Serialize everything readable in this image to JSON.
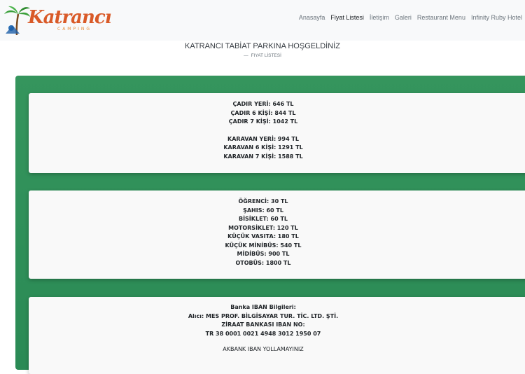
{
  "brand": {
    "name": "Katrancı",
    "tagline": "CAMPING"
  },
  "nav": [
    {
      "label": "Anasayfa",
      "active": false
    },
    {
      "label": "Fiyat Listesi",
      "active": true
    },
    {
      "label": "İletişim",
      "active": false
    },
    {
      "label": "Galeri",
      "active": false
    },
    {
      "label": "Restaurant Menu",
      "active": false
    },
    {
      "label": "Infinity Ruby Hotel",
      "active": false
    }
  ],
  "header": {
    "title": "KATRANCI TABİAT PARKINA HOŞGELDİNİZ",
    "breadcrumb": "FIYAT LİSTESİ"
  },
  "cards": {
    "tent": [
      "ÇADIR YERİ: 646 TL",
      "ÇADIR 6 KİŞİ: 844 TL",
      "ÇADIR 7 KİŞİ: 1042 TL"
    ],
    "caravan": [
      "KARAVAN YERİ: 994 TL",
      "KARAVAN 6 KİŞİ: 1291 TL",
      "KARAVAN 7 KİŞİ: 1588 TL"
    ],
    "entry": [
      "ÖĞRENCİ: 30 TL",
      "ŞAHIS: 60 TL",
      "BİSİKLET: 60 TL",
      "MOTORSİKLET: 120 TL",
      "KÜÇÜK VASITA: 180 TL",
      "KÜÇÜK MİNİBÜS: 540 TL",
      "MİDİBÜS: 900 TL",
      "OTOBÜS: 1800 TL"
    ],
    "bank": [
      "Banka IBAN Bilgileri:",
      "Alıcı: MES PROF. BİLGİSAYAR TUR. TİC. LTD. ŞTİ.",
      "ZİRAAT BANKASI IBAN NO:",
      "TR 38 0001 0021 4948 3012 1950 07"
    ],
    "bank_note": "AKBANK IBAN YOLLAMAYINIZ"
  },
  "colors": {
    "accent_green": "#35955d",
    "logo_orange": "#d95a28"
  }
}
